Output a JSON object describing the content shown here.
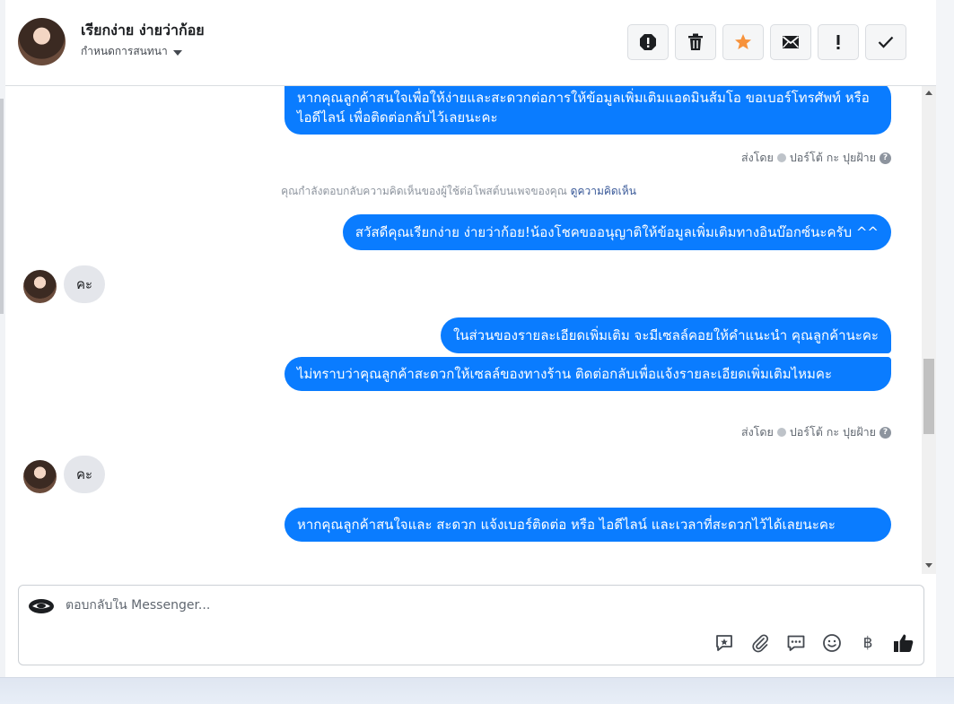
{
  "header": {
    "contact_name": "เรียกง่าย ง่ายว่าก้อย",
    "assign_label": "กำหนดการสนทนา"
  },
  "toolbar": [
    {
      "name": "report-spam-icon"
    },
    {
      "name": "trash-icon"
    },
    {
      "name": "star-icon"
    },
    {
      "name": "mail-icon"
    },
    {
      "name": "exclamation-icon"
    },
    {
      "name": "check-icon"
    }
  ],
  "messages": {
    "m1": "หากคุณลูกค้าสนใจเพื่อให้ง่ายและสะดวกต่อการให้ข้อมูลเพิ่มเติมแอดมินส้มโอ ขอเบอร์โทรศัพท์ หรือ ไอดีไลน์ เพื่อติดต่อกลับไว้เลยนะคะ",
    "sent_by_1_prefix": "ส่งโดย",
    "sent_by_1_name": "ปอร์โต้ กะ ปุยฝ้าย",
    "system_note": "คุณกำลังตอบกลับความคิดเห็นของผู้ใช้ต่อโพสต์บนเพจของคุณ",
    "system_link": "ดูความคิดเห็น",
    "m2": "สวัสดีคุณเรียกง่าย ง่ายว่าก้อย!น้องโชคขออนุญาติให้ข้อมูลเพิ่มเติมทางอินบ๊อกซ์นะครับ ^^",
    "in1": "คะ",
    "m3": "ในส่วนของรายละเอียดเพิ่มเติม จะมีเซลล์คอยให้คำแนะนำ คุณลูกค้านะคะ",
    "m4": "ไม่ทราบว่าคุณลูกค้าสะดวกให้เซลล์ของทางร้าน ติดต่อกลับเพื่อแจ้งรายละเอียดเพิ่มเติมไหมคะ",
    "sent_by_2_prefix": "ส่งโดย",
    "sent_by_2_name": "ปอร์โต้ กะ ปุยฝ้าย",
    "in2": "คะ",
    "m5": "หากคุณลูกค้าสนใจและ สะดวก แจ้งเบอร์ติดต่อ หรือ ไอดีไลน์ และเวลาที่สะดวกไว้ได้เลยนะคะ"
  },
  "composer": {
    "placeholder": "ตอบกลับใน Messenger...",
    "baht_symbol": "฿"
  },
  "colors": {
    "outgoing_bubble": "#0a7cff",
    "incoming_bubble": "#e4e6eb",
    "star": "#f7923b"
  }
}
